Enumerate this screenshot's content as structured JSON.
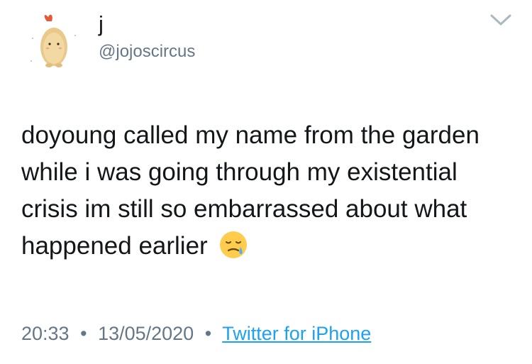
{
  "user": {
    "display_name": "j",
    "handle": "@jojoscircus",
    "avatar_icon": "ebi-fry-plush-icon"
  },
  "menu_icon": "chevron-down-icon",
  "tweet": {
    "text": "doyoung called my name from the garden while i was going through my existential crisis im still so embarrassed about what happened earlier",
    "emoji": "😪",
    "emoji_icon": "sleepy-face-icon"
  },
  "meta": {
    "time": "20:33",
    "separator": "•",
    "date": "13/05/2020",
    "source": "Twitter for iPhone"
  },
  "colors": {
    "text": "#14171a",
    "secondary": "#657786",
    "link": "#1da1f2"
  }
}
